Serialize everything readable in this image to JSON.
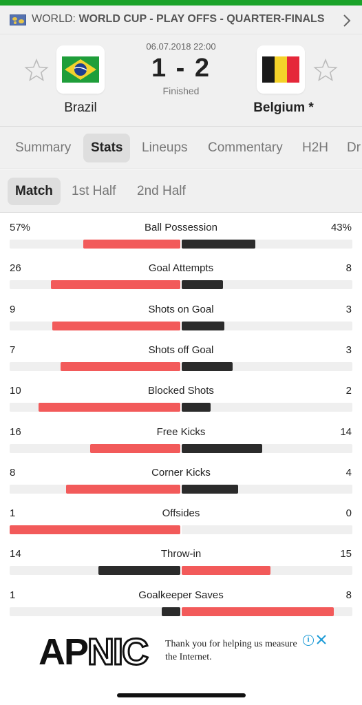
{
  "league": {
    "prefix": "WORLD:",
    "name": "WORLD CUP - PLAY OFFS - QUARTER-FINALS"
  },
  "match": {
    "date": "06.07.2018 22:00",
    "score": "1 - 2",
    "status": "Finished",
    "home_team": "Brazil",
    "away_team": "Belgium *"
  },
  "tabs": [
    "Summary",
    "Stats",
    "Lineups",
    "Commentary",
    "H2H",
    "Dr"
  ],
  "active_tab": "Stats",
  "subtabs": [
    "Match",
    "1st Half",
    "2nd Half"
  ],
  "active_subtab": "Match",
  "colors": {
    "leader": "#f25a5a",
    "trailer": "#2b2b2b",
    "accent": "#1ba32a"
  },
  "stats": [
    {
      "name": "Ball Possession",
      "home": "57%",
      "away": "43%",
      "home_share": 0.57,
      "away_share": 0.43
    },
    {
      "name": "Goal Attempts",
      "home": "26",
      "away": "8",
      "home_share": 0.76,
      "away_share": 0.24
    },
    {
      "name": "Shots on Goal",
      "home": "9",
      "away": "3",
      "home_share": 0.75,
      "away_share": 0.25
    },
    {
      "name": "Shots off Goal",
      "home": "7",
      "away": "3",
      "home_share": 0.7,
      "away_share": 0.3
    },
    {
      "name": "Blocked Shots",
      "home": "10",
      "away": "2",
      "home_share": 0.83,
      "away_share": 0.17
    },
    {
      "name": "Free Kicks",
      "home": "16",
      "away": "14",
      "home_share": 0.53,
      "away_share": 0.47
    },
    {
      "name": "Corner Kicks",
      "home": "8",
      "away": "4",
      "home_share": 0.67,
      "away_share": 0.33
    },
    {
      "name": "Offsides",
      "home": "1",
      "away": "0",
      "home_share": 1.0,
      "away_share": 0.0
    },
    {
      "name": "Throw-in",
      "home": "14",
      "away": "15",
      "home_share": 0.48,
      "away_share": 0.52
    },
    {
      "name": "Goalkeeper Saves",
      "home": "1",
      "away": "8",
      "home_share": 0.11,
      "away_share": 0.89
    }
  ],
  "ad": {
    "brand": "APNIC",
    "text": "Thank you for helping us measure the Internet.",
    "info_icon": "info-icon",
    "close_icon": "close-icon"
  }
}
